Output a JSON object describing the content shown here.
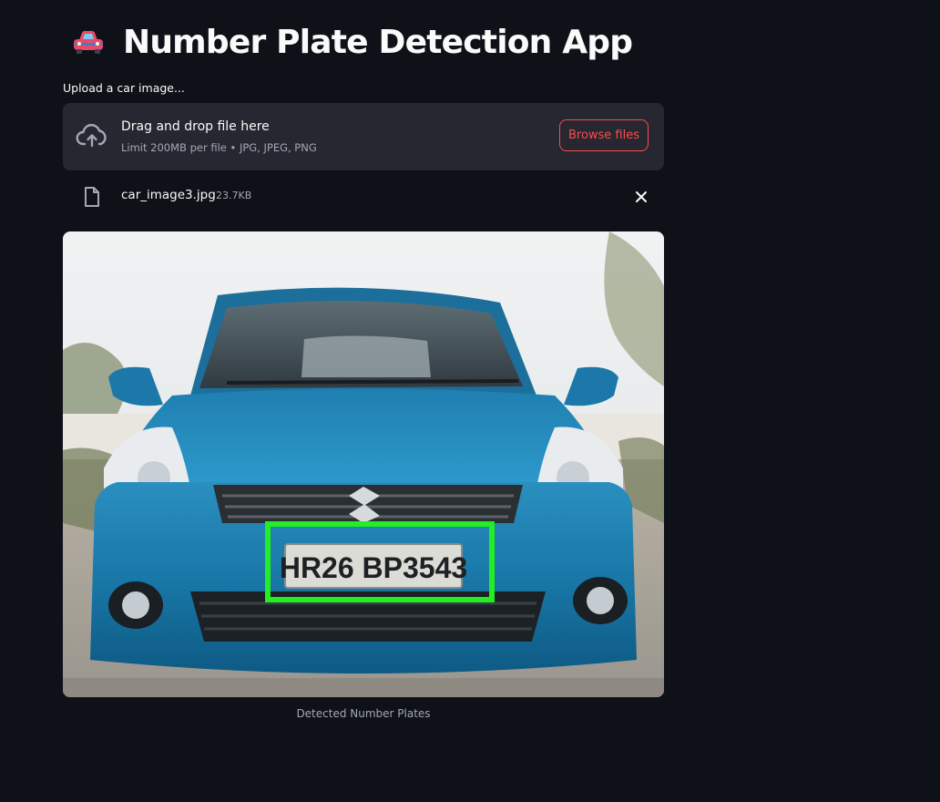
{
  "header": {
    "icon": "car-emoji-icon",
    "title": "Number Plate Detection App"
  },
  "uploader": {
    "label": "Upload a car image...",
    "drop_title": "Drag and drop file here",
    "limit_text": "Limit 200MB per file • JPG, JPEG, PNG",
    "browse_label": "Browse files"
  },
  "uploaded_file": {
    "name": "car_image3.jpg",
    "size": "23.7KB"
  },
  "result": {
    "plate_text": "HR26 BP3543",
    "caption": "Detected Number Plates"
  },
  "colors": {
    "background": "#0e1117",
    "panel": "#262730",
    "accent": "#ff4b4b",
    "detection_box": "#22ee22"
  }
}
